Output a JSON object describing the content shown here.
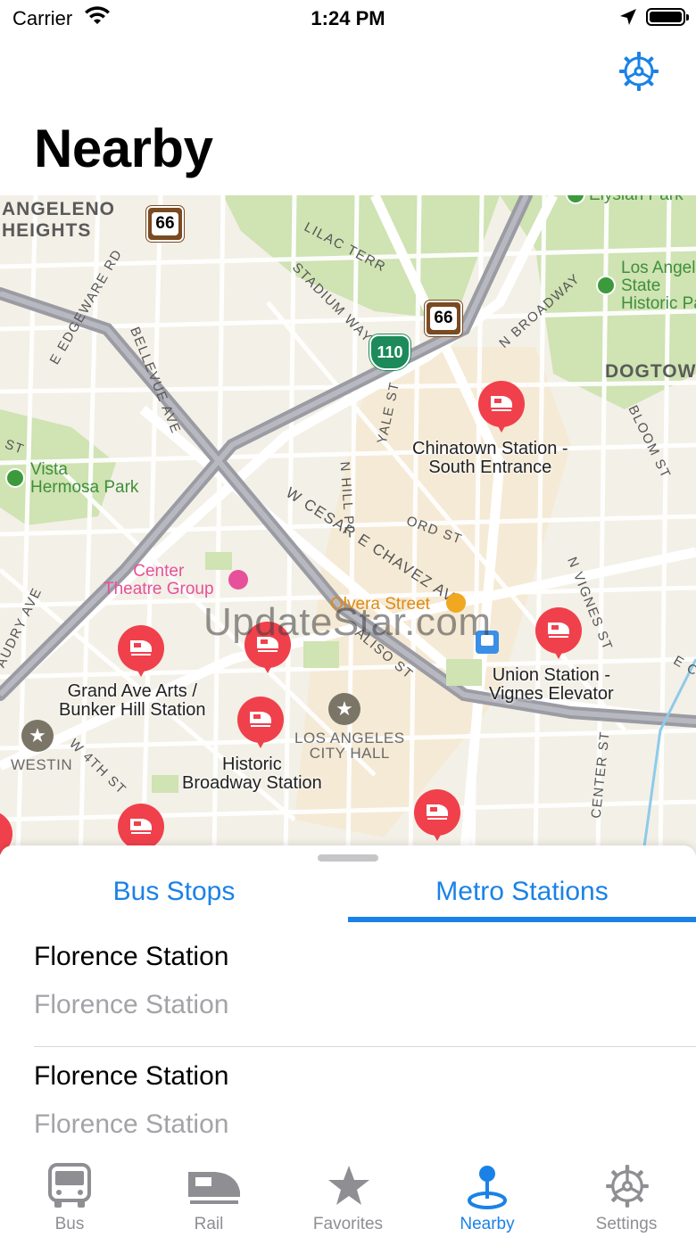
{
  "status_bar": {
    "carrier": "Carrier",
    "time": "1:24 PM"
  },
  "header": {
    "title": "Nearby",
    "settings_icon": "gear-steering-icon"
  },
  "map": {
    "watermark": "UpdateStar.com",
    "areas": {
      "angeleno": "ANGELENO\nHEIGHTS",
      "dogtown": "DOGTOWN"
    },
    "parks": {
      "elysian": "Elysian Park",
      "la_state": "Los Angeles\nState\nHistoric Park",
      "vista": "Vista\nHermosa Park"
    },
    "roads": {
      "lilac": "LILAC TERR",
      "stadium": "STADIUM WAY",
      "edgeware": "E EDGEWARE RD",
      "bellevue": "BELLEVUE AVE",
      "n_broadway": "N BROADWAY",
      "yale": "YALE ST",
      "n_hill": "N HILL PL",
      "cesar": "W CESAR E CHAVEZ AVE",
      "ord": "ORD ST",
      "alameda": "N VIGNES ST",
      "bloom": "BLOOM ST",
      "w4th": "W 4TH ST",
      "audry": "AUDRY AVE",
      "alisot": "ALISO ST",
      "center": "CENTER ST",
      "st": "ST",
      "e_c": "E C"
    },
    "highway_shields": {
      "route66": "66",
      "i110": "110"
    },
    "pois": {
      "center_theatre": "Center\nTheatre Group",
      "olvera": "Olvera Street",
      "city_hall": "LOS ANGELES\nCITY HALL",
      "westin": "WESTIN"
    },
    "stations": {
      "chinatown": "Chinatown Station -\nSouth Entrance",
      "union": "Union Station -\nVignes Elevator",
      "grand": "Grand Ave Arts /\nBunker Hill Station",
      "historic": "Historic\nBroadway Station"
    }
  },
  "sheet": {
    "tabs": [
      "Bus Stops",
      "Metro Stations"
    ],
    "active_tab": "Metro Stations",
    "items": [
      {
        "title": "Florence Station",
        "subtitle": "Florence Station"
      },
      {
        "title": "Florence Station",
        "subtitle": "Florence Station"
      }
    ]
  },
  "tab_bar": {
    "items": [
      {
        "label": "Bus",
        "icon": "bus-icon"
      },
      {
        "label": "Rail",
        "icon": "rail-icon"
      },
      {
        "label": "Favorites",
        "icon": "star-icon"
      },
      {
        "label": "Nearby",
        "icon": "location-pin-icon"
      },
      {
        "label": "Settings",
        "icon": "gear-icon"
      }
    ],
    "active": "Nearby"
  },
  "colors": {
    "accent": "#1a82e6",
    "pin": "#f0404c",
    "inactive": "#8e8e93"
  }
}
